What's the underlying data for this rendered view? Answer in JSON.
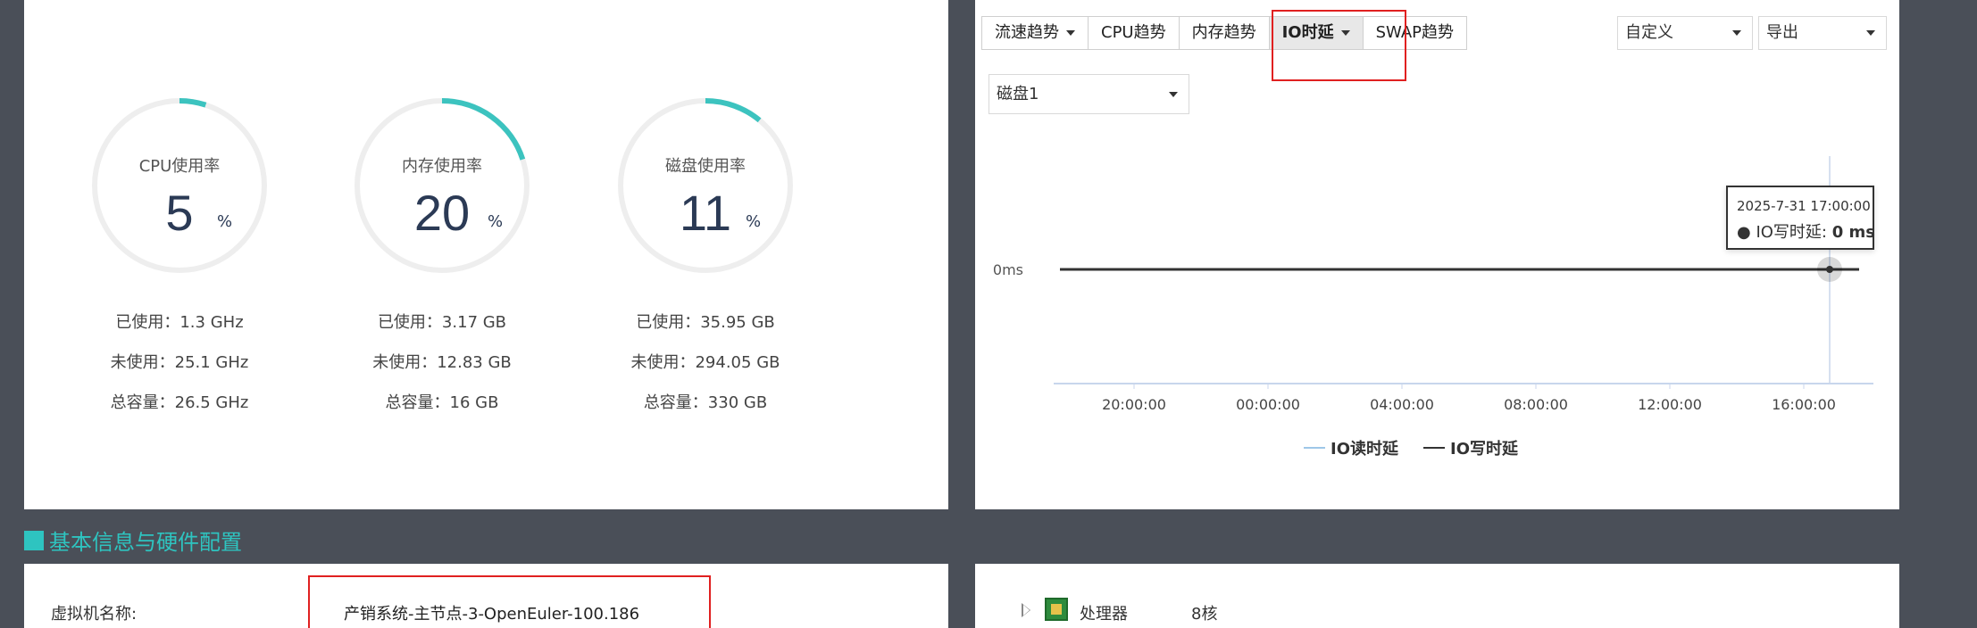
{
  "gauges": [
    {
      "title": "CPU使用率",
      "value": "5",
      "unit": "%",
      "percent": 5,
      "used": "已使用：1.3 GHz",
      "free": "未使用：25.1 GHz",
      "total": "总容量：26.5 GHz"
    },
    {
      "title": "内存使用率",
      "value": "20",
      "unit": "%",
      "percent": 20,
      "used": "已使用：3.17 GB",
      "free": "未使用：12.83 GB",
      "total": "总容量：16 GB"
    },
    {
      "title": "磁盘使用率",
      "value": "11",
      "unit": "%",
      "percent": 11,
      "used": "已使用：35.95 GB",
      "free": "未使用：294.05 GB",
      "total": "总容量：330 GB"
    }
  ],
  "colors": {
    "accent": "#3cc3bf",
    "ring_bg": "#eeeeee",
    "highlight": "#e02020"
  },
  "tabs": [
    {
      "label": "流速趋势",
      "dropdown": true
    },
    {
      "label": "CPU趋势",
      "dropdown": false
    },
    {
      "label": "内存趋势",
      "dropdown": false
    },
    {
      "label": "IO时延",
      "dropdown": true,
      "active": true
    },
    {
      "label": "SWAP趋势",
      "dropdown": false
    }
  ],
  "range_select": "自定义",
  "export_select": "导出",
  "disk_select": "磁盘1",
  "chart_data": {
    "type": "line",
    "ylabel_tick": "0ms",
    "x_ticks": [
      "20:00:00",
      "00:00:00",
      "04:00:00",
      "08:00:00",
      "12:00:00",
      "16:00:00"
    ],
    "series": [
      {
        "name": "IO读时延",
        "color": "#9ec7e8",
        "values": [
          0,
          0,
          0,
          0,
          0,
          0
        ]
      },
      {
        "name": "IO写时延",
        "color": "#333333",
        "values": [
          0,
          0,
          0,
          0,
          0,
          0
        ]
      }
    ],
    "tooltip": {
      "time": "2025-7-31 17:00:00",
      "label": "IO写时延:",
      "value": "0 ms"
    }
  },
  "section_title": "基本信息与硬件配置",
  "vm": {
    "label": "虚拟机名称:",
    "value": "产销系统-主节点-3-OpenEuler-100.186"
  },
  "hardware": {
    "label": "处理器",
    "value": "8核"
  }
}
